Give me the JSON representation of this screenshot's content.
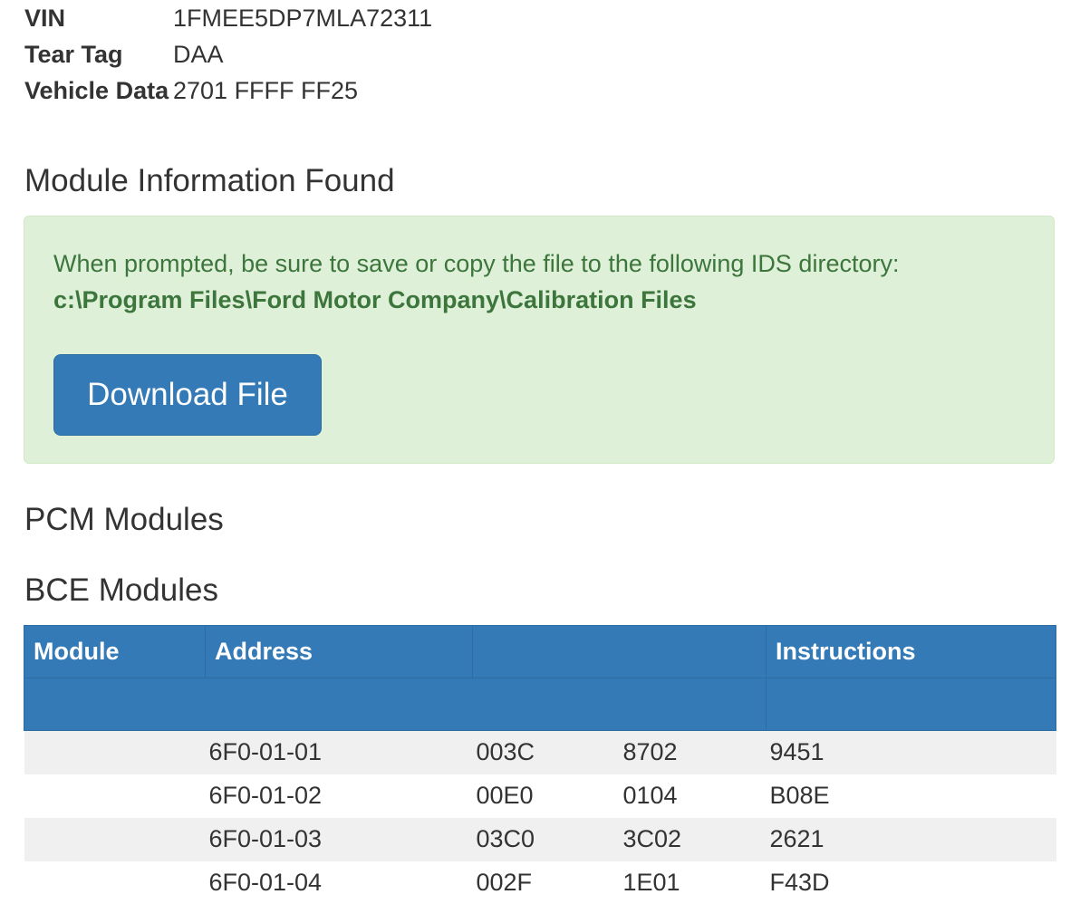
{
  "vehicle": {
    "vin_label": "VIN",
    "vin_value": "1FMEE5DP7MLA72311",
    "tear_tag_label": "Tear Tag",
    "tear_tag_value": "DAA",
    "vehicle_data_label": "Vehicle Data",
    "vehicle_data_value": "2701 FFFF FF25"
  },
  "module_info": {
    "heading": "Module Information Found",
    "instruction": "When prompted, be sure to save or copy the file to the following IDS directory:",
    "directory": "c:\\Program Files\\Ford Motor Company\\Calibration Files",
    "download_label": "Download File"
  },
  "pcm": {
    "heading": "PCM Modules"
  },
  "bce": {
    "heading": "BCE Modules",
    "columns": {
      "module": "Module",
      "address": "Address",
      "blank": "",
      "instructions": "Instructions"
    },
    "rows": [
      {
        "module": "",
        "address": "6F0-01-01",
        "val1": "003C",
        "val2": "8702",
        "instructions": "9451"
      },
      {
        "module": "",
        "address": "6F0-01-02",
        "val1": "00E0",
        "val2": "0104",
        "instructions": "B08E"
      },
      {
        "module": "",
        "address": "6F0-01-03",
        "val1": "03C0",
        "val2": "3C02",
        "instructions": "2621"
      },
      {
        "module": "",
        "address": "6F0-01-04",
        "val1": "002F",
        "val2": "1E01",
        "instructions": "F43D"
      }
    ]
  },
  "colors": {
    "header_bg": "#337ab7",
    "alert_bg": "#dff0d8",
    "alert_text": "#3c763d",
    "stripe": "#f0f0f0"
  }
}
